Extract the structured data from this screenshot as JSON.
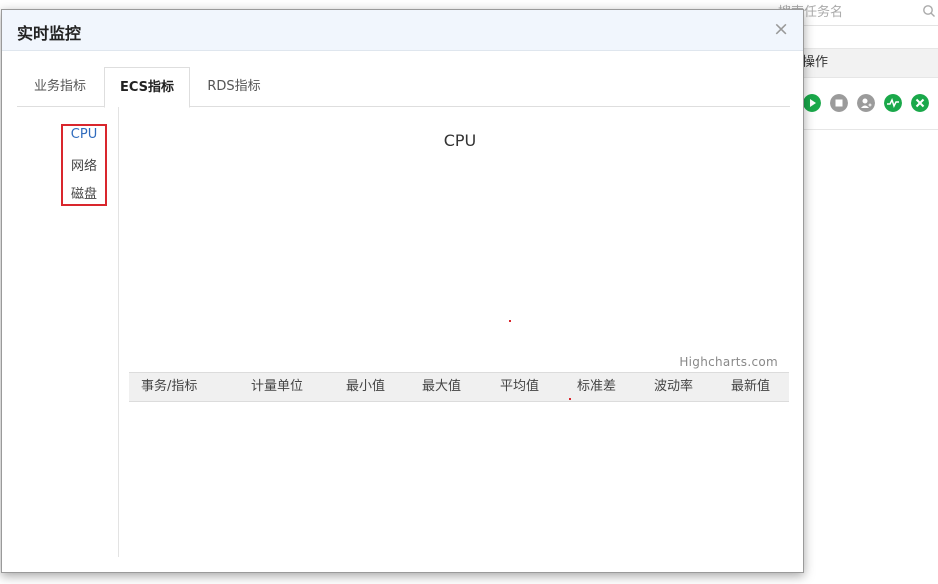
{
  "background": {
    "search": {
      "placeholder": "搜索任务名",
      "icon": "search-icon"
    },
    "table_header": {
      "operation_label": "操作"
    },
    "row_actions": [
      {
        "name": "start-icon",
        "color": "#1aa84a"
      },
      {
        "name": "stop-icon",
        "color": "#9b9b9b"
      },
      {
        "name": "add-user-icon",
        "color": "#9b9b9b"
      },
      {
        "name": "monitor-icon",
        "color": "#1aa84a"
      },
      {
        "name": "delete-icon",
        "color": "#1aa84a"
      }
    ]
  },
  "modal": {
    "title": "实时监控",
    "close": "×",
    "tabs": [
      {
        "label": "业务指标",
        "active": false
      },
      {
        "label": "ECS指标",
        "active": true
      },
      {
        "label": "RDS指标",
        "active": false
      }
    ],
    "nav_items": [
      {
        "label": "CPU",
        "active": true
      },
      {
        "label": "网络",
        "active": false
      },
      {
        "label": "磁盘",
        "active": false
      }
    ],
    "chart": {
      "title": "CPU",
      "credits": "Highcharts.com"
    },
    "table": {
      "headers": [
        "事务/指标",
        "计量单位",
        "最小值",
        "最大值",
        "平均值",
        "标准差",
        "波动率",
        "最新值"
      ]
    }
  },
  "colors": {
    "accent_blue": "#2f6bbd",
    "highlight_red": "#d9262d",
    "header_bg": "#f1f6fd"
  }
}
